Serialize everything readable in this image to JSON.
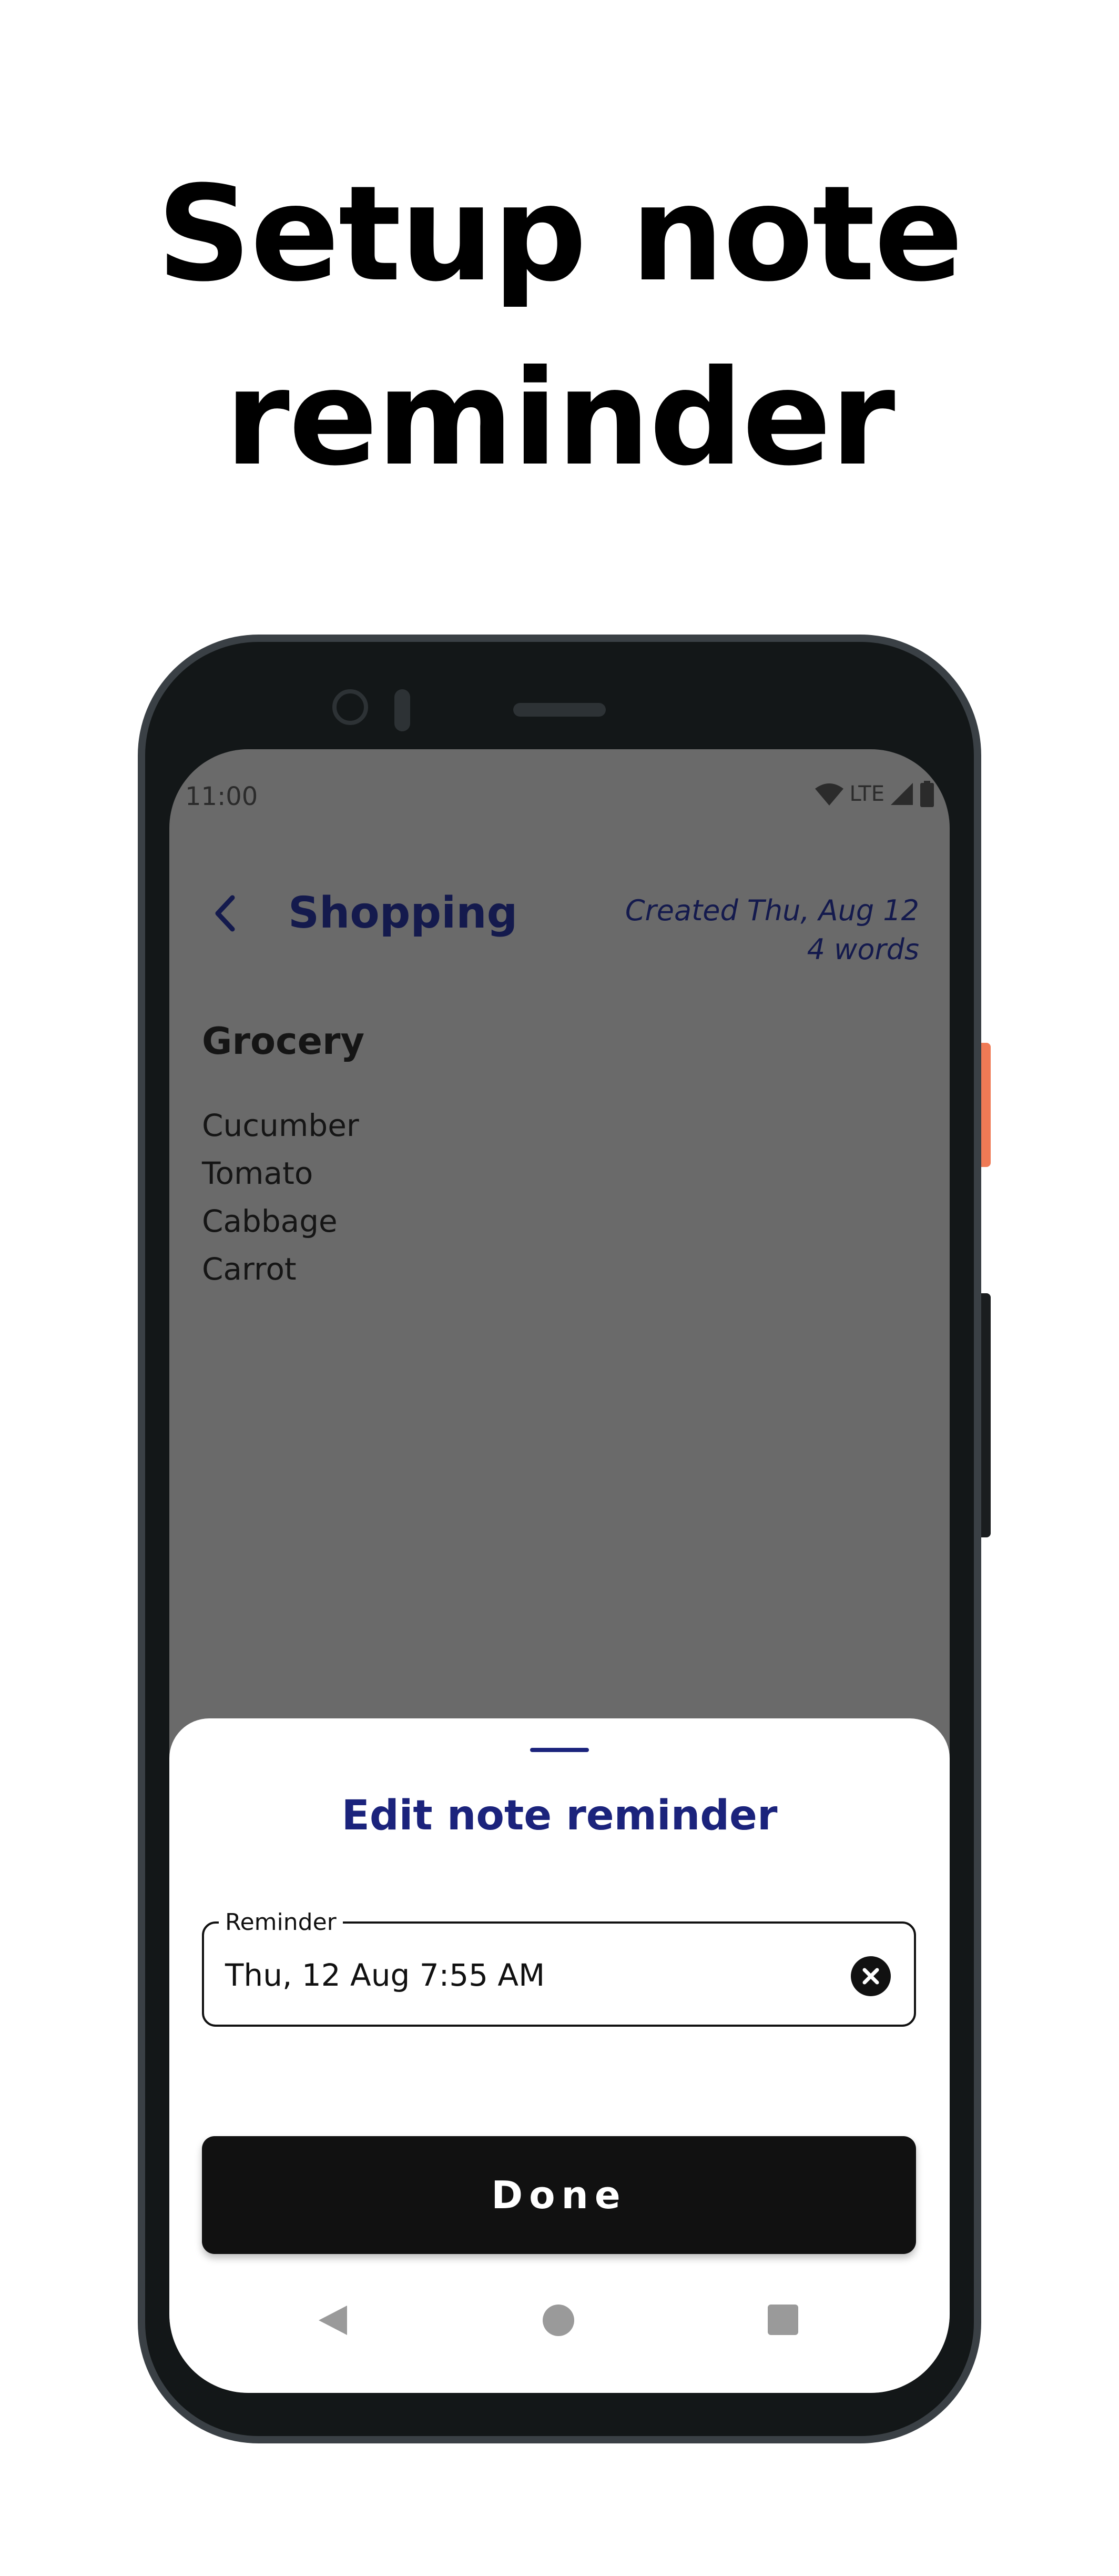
{
  "headline": {
    "line1": "Setup note",
    "line2": "reminder"
  },
  "status_bar": {
    "time": "11:00",
    "network": "LTE",
    "icons": [
      "wifi-icon",
      "signal-icon",
      "battery-icon"
    ]
  },
  "note": {
    "title": "Shopping",
    "created": "Created Thu, Aug 12",
    "word_count": "4 words",
    "heading": "Grocery",
    "items": [
      "Cucumber",
      "Tomato",
      "Cabbage",
      "Carrot"
    ]
  },
  "sheet": {
    "title": "Edit note reminder",
    "field_label": "Reminder",
    "field_value": "Thu, 12 Aug 7:55 AM",
    "done_label": "Done"
  },
  "nav_bar": {
    "icons": [
      "nav-back-icon",
      "nav-home-icon",
      "nav-recents-icon"
    ]
  },
  "colors": {
    "accent": "#1b237c",
    "scrim": "#6a6a6a",
    "button": "#111111",
    "phone_frame": "#3a4045",
    "side_button": "#f07a55"
  }
}
